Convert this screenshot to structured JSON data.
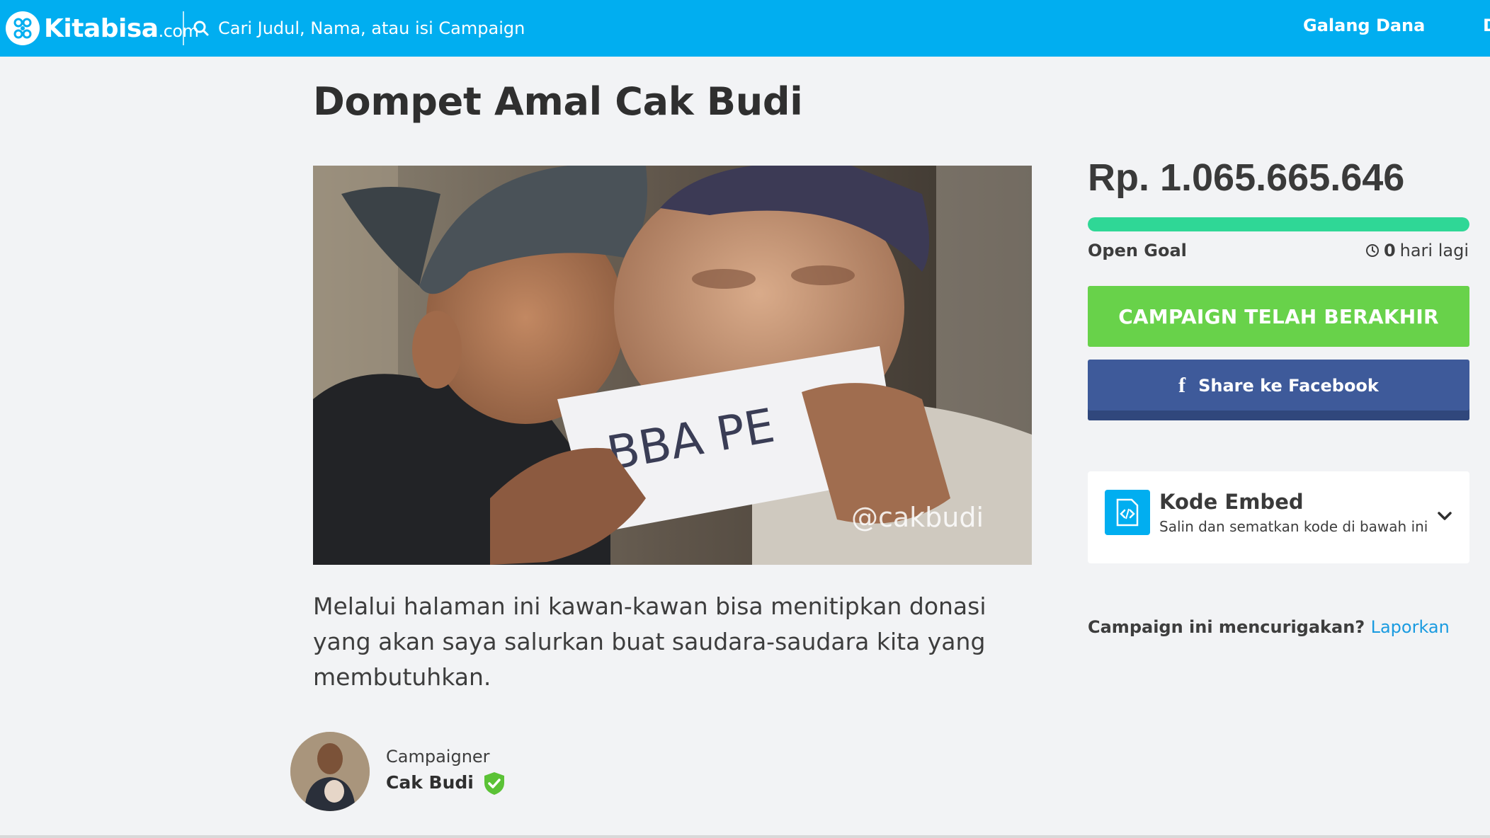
{
  "header": {
    "logo_text": "Kitabisa",
    "logo_suffix": ".com",
    "search_placeholder": "Cari Judul, Nama, atau isi Campaign",
    "nav": [
      "Galang Dana",
      "D"
    ]
  },
  "campaign": {
    "title": "Dompet Amal Cak Budi",
    "image_alt": "Campaign photo",
    "image_overlay_text": "@cakbudi",
    "image_paper_text": "BBA PE",
    "description": "Melalui halaman ini kawan-kawan bisa menitipkan donasi yang akan saya salurkan buat saudara-saudara kita yang membutuhkan."
  },
  "campaigner": {
    "role": "Campaigner",
    "name": "Cak Budi",
    "verified": true
  },
  "donation": {
    "amount": "Rp. 1.065.665.646",
    "progress_percent": 100,
    "goal_label": "Open Goal",
    "days_left_number": "0",
    "days_left_suffix": "hari lagi",
    "ended_button": "CAMPAIGN TELAH BERAKHIR",
    "facebook_button": "Share ke Facebook"
  },
  "embed": {
    "title": "Kode Embed",
    "subtitle": "Salin dan sematkan kode di bawah ini"
  },
  "report": {
    "question": "Campaign ini mencurigakan?",
    "link": "Laporkan"
  },
  "colors": {
    "brand_blue": "#01aef0",
    "progress_green": "#2fd796",
    "ended_green": "#68d24a",
    "facebook_blue": "#3e5a9a",
    "link_blue": "#1a9be0"
  }
}
